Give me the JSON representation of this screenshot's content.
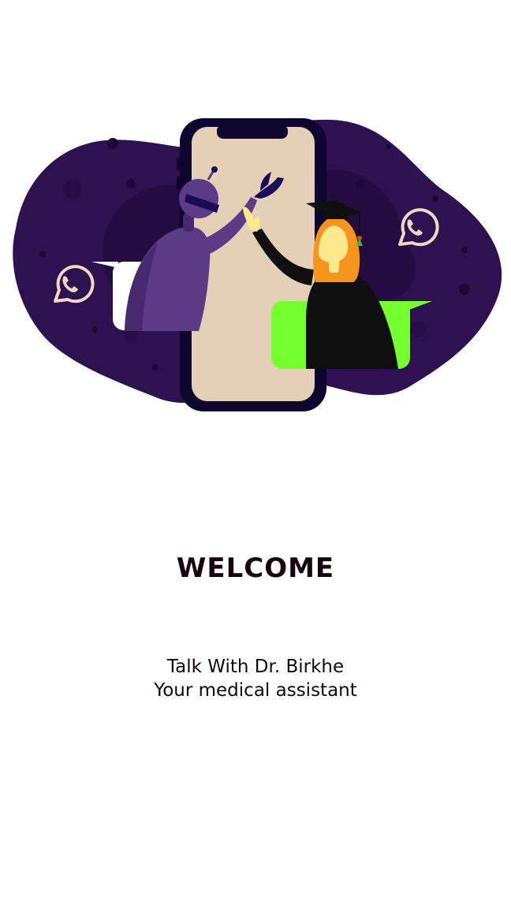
{
  "screen": {
    "title": "WELCOME",
    "subtitle_line1": "Talk With Dr. Birkhe",
    "subtitle_line2": "Your medical assistant"
  },
  "illustration": {
    "icon": "whatsapp-icon",
    "colors": {
      "blob": "#2d1150",
      "phone_frame": "#0e0430",
      "phone_screen": "#e3d0b7",
      "robot": "#5b3a86",
      "bubble_green": "#76ff2f",
      "bubble_white": "#ffffff",
      "graduate_gown": "#0f0f0f",
      "hair": "#f7941d",
      "skin": "#fde98b"
    }
  }
}
